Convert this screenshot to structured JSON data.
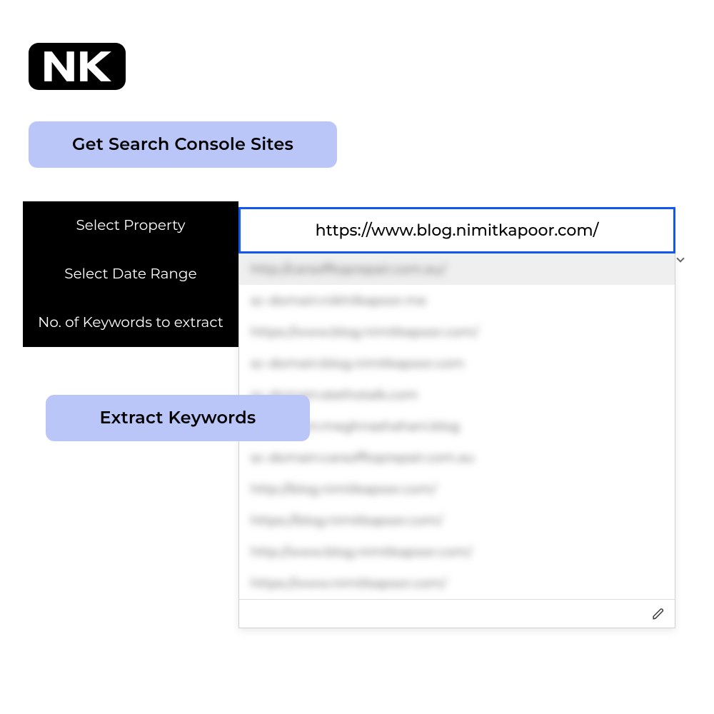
{
  "logo": {
    "text": "NK"
  },
  "buttons": {
    "get_sites": "Get Search Console Sites",
    "extract": "Extract Keywords"
  },
  "form": {
    "labels": {
      "property": "Select Property",
      "date_range": "Select Date Range",
      "keywords": "No. of Keywords to extract"
    }
  },
  "dropdown": {
    "selected": "https://www.blog.nimitkapoor.com/",
    "options": [
      "http://carsofftoprepair.com.au/",
      "sc-domain:nikhilkapoor.me",
      "https://www.blog.nimitkapoor.com/",
      "sc-domain:blog.nimitkapoor.com",
      "sc-domain:stethotalk.com",
      "sc-domain:meghnashahani.blog",
      "sc-domain:carsofftoprepair.com.au",
      "http://blog.nimitkapoor.com/",
      "https://blog.nimitkapoor.com/",
      "http://www.blog.nimitkapoor.com/",
      "https://www.nimitkapoor.com/"
    ]
  }
}
